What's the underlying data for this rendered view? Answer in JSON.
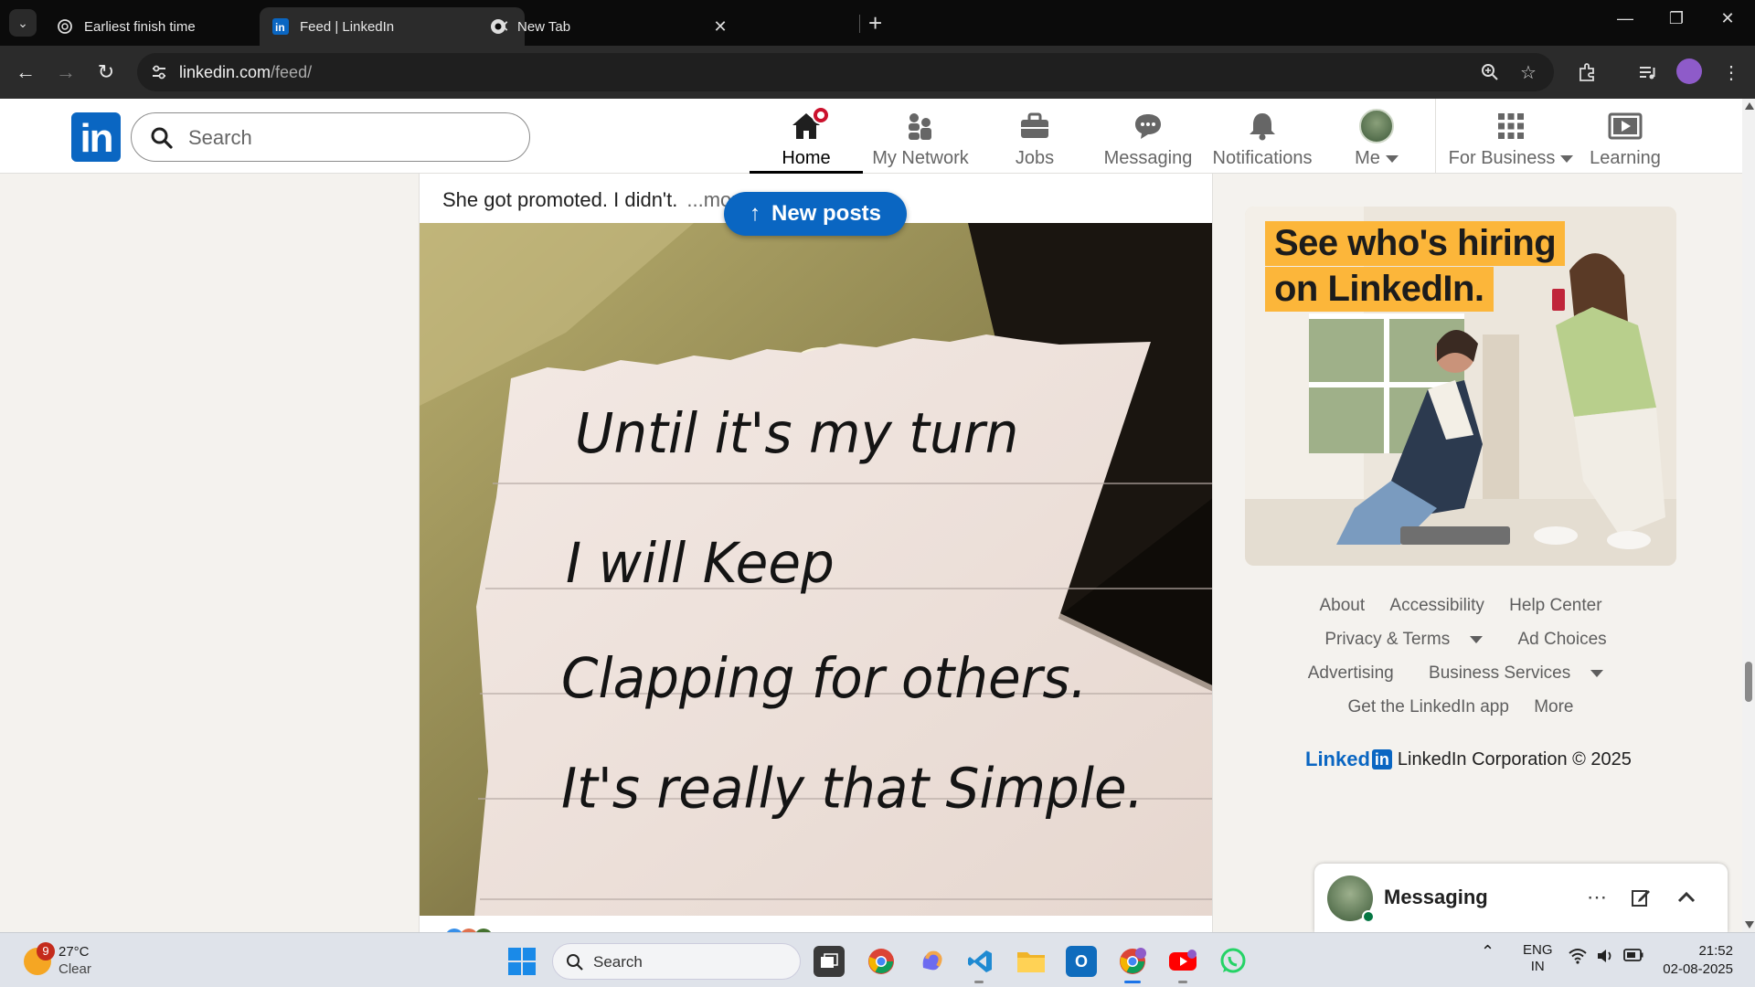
{
  "browser": {
    "tabs": [
      {
        "title": "Earliest finish time",
        "icon": "chatgpt-icon",
        "active": false
      },
      {
        "title": "Feed | LinkedIn",
        "icon": "linkedin-icon",
        "active": true
      },
      {
        "title": "New Tab",
        "icon": "chrome-icon",
        "active": false
      }
    ],
    "url_host": "linkedin.com",
    "url_path": "/feed/"
  },
  "linkedin": {
    "logo_text": "in",
    "search_placeholder": "Search",
    "nav": [
      {
        "label": "Home",
        "icon": "home-icon",
        "active": true,
        "badge": true
      },
      {
        "label": "My Network",
        "icon": "network-icon"
      },
      {
        "label": "Jobs",
        "icon": "briefcase-icon"
      },
      {
        "label": "Messaging",
        "icon": "chat-icon"
      },
      {
        "label": "Notifications",
        "icon": "bell-icon"
      },
      {
        "label": "Me",
        "icon": "avatar",
        "dropdown": true
      },
      {
        "label": "For Business",
        "icon": "grid-icon",
        "dropdown": true
      },
      {
        "label": "Learning",
        "icon": "play-icon"
      }
    ],
    "brand_color": "#0a66c2"
  },
  "post": {
    "text": "She got promoted. I didn't.",
    "more_label": "...more",
    "image_lines": [
      "Until it's my turn",
      "I will Keep",
      "Clapping for others.",
      "It's really that Simple."
    ]
  },
  "new_posts_label": "New posts",
  "ad": {
    "line1": "See who's hiring",
    "line2": "on LinkedIn.",
    "accent_color": "#fcb63a"
  },
  "footer": {
    "rows": [
      [
        "About",
        "Accessibility",
        "Help Center"
      ],
      [
        "Privacy & Terms",
        "Ad Choices"
      ],
      [
        "Advertising",
        "Business Services"
      ],
      [
        "Get the LinkedIn app",
        "More"
      ]
    ],
    "brand": "Linked",
    "brand_in": "in",
    "corp": "LinkedIn Corporation © 2025"
  },
  "messaging": {
    "title": "Messaging"
  },
  "taskbar": {
    "weather_badge": "9",
    "temperature": "27°C",
    "condition": "Clear",
    "search_label": "Search",
    "lang": "ENG",
    "region": "IN",
    "time": "21:52",
    "date": "02-08-2025"
  }
}
